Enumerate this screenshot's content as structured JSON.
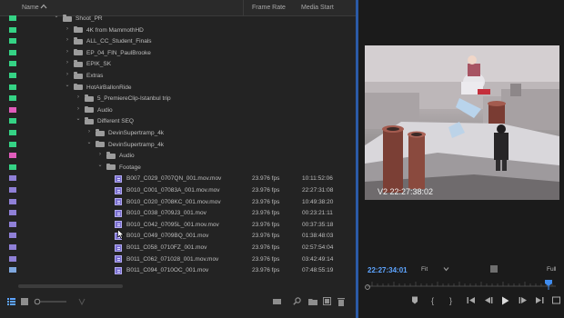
{
  "project": {
    "columns": {
      "name": "Name",
      "sort_icon": "chevron-up-icon",
      "frame_rate": "Frame Rate",
      "media_start": "Media Start"
    },
    "colors": {
      "green": "#35d385",
      "pink": "#e05cbb",
      "violet": "#8f80d7",
      "blue": "#7fa7de"
    },
    "rows": [
      {
        "type": "folder",
        "name": "Shoot_PR",
        "depth": 0,
        "expanded": true,
        "label": "green"
      },
      {
        "type": "folder",
        "name": "4K from MammothHD",
        "depth": 1,
        "expanded": false,
        "label": "green"
      },
      {
        "type": "folder",
        "name": "ALL_CC_Student_Finals",
        "depth": 1,
        "expanded": false,
        "label": "green"
      },
      {
        "type": "folder",
        "name": "EP_04_FIN_PaulBrooke",
        "depth": 1,
        "expanded": false,
        "label": "green"
      },
      {
        "type": "folder",
        "name": "EPIK_SK",
        "depth": 1,
        "expanded": false,
        "label": "green"
      },
      {
        "type": "folder",
        "name": "Extras",
        "depth": 1,
        "expanded": false,
        "label": "green"
      },
      {
        "type": "folder",
        "name": "HotAirBallonRide",
        "depth": 1,
        "expanded": true,
        "label": "green"
      },
      {
        "type": "folder",
        "name": "5_PremiereClip-Istanbul trip",
        "depth": 2,
        "expanded": false,
        "label": "green"
      },
      {
        "type": "folder",
        "name": "Audio",
        "depth": 2,
        "expanded": false,
        "label": "pink"
      },
      {
        "type": "folder",
        "name": "Different SEQ",
        "depth": 2,
        "expanded": true,
        "label": "green"
      },
      {
        "type": "folder",
        "name": "DevinSupertramp_4k",
        "depth": 3,
        "expanded": false,
        "label": "green"
      },
      {
        "type": "folder",
        "name": "DevinSupertramp_4k",
        "depth": 3,
        "expanded": true,
        "label": "green"
      },
      {
        "type": "folder",
        "name": "Audio",
        "depth": 4,
        "expanded": false,
        "label": "pink"
      },
      {
        "type": "folder",
        "name": "Footage",
        "depth": 4,
        "expanded": true,
        "label": "green"
      },
      {
        "type": "clip",
        "name": "B007_C029_0707QN_001.mov.mov",
        "fps": "23.976 fps",
        "start": "10:11:52:06",
        "label": "violet"
      },
      {
        "type": "clip",
        "name": "B010_C001_07083A_001.mov.mov",
        "fps": "23.976 fps",
        "start": "22:27:31:08",
        "label": "violet"
      },
      {
        "type": "clip",
        "name": "B010_C020_0708KC_001.mov.mov",
        "fps": "23.976 fps",
        "start": "10:49:38:20",
        "label": "violet"
      },
      {
        "type": "clip",
        "name": "B010_C038_0709J3_001.mov",
        "fps": "23.976 fps",
        "start": "00:23:21:11",
        "label": "violet"
      },
      {
        "type": "clip",
        "name": "B010_C042_07095L_001.mov.mov",
        "fps": "23.976 fps",
        "start": "00:37:35:18",
        "label": "violet"
      },
      {
        "type": "clip",
        "name": "B010_C049_0709BQ_001.mov",
        "fps": "23.976 fps",
        "start": "01:38:48:03",
        "label": "violet"
      },
      {
        "type": "clip",
        "name": "B011_C058_0710FZ_001.mov",
        "fps": "23.976 fps",
        "start": "02:57:54:04",
        "label": "violet"
      },
      {
        "type": "clip",
        "name": "B011_C062_071028_001.mov.mov",
        "fps": "23.976 fps",
        "start": "03:42:49:14",
        "label": "violet"
      },
      {
        "type": "clip",
        "name": "B011_C094_0710OC_001.mov",
        "fps": "23.976 fps",
        "start": "07:48:55:19",
        "label": "blue"
      }
    ],
    "bottom_icons": [
      "list-view-icon",
      "icon-view-icon",
      "zoom-slider",
      "automate-icon",
      "search-icon",
      "new-bin-icon",
      "new-item-icon",
      "delete-icon"
    ]
  },
  "monitor": {
    "overlay_timecode": "V2 22:27:38:02",
    "current_timecode": "22:27:34:01",
    "fit_label": "Fit",
    "resolution_label": "Full",
    "transport_icons": [
      "add-marker-icon",
      "mark-in-icon",
      "mark-out-icon",
      "go-to-in-icon",
      "step-back-icon",
      "play-icon",
      "step-forward-icon",
      "go-to-out-icon",
      "insert-icon",
      "overwrite-icon",
      "export-frame-icon"
    ]
  }
}
